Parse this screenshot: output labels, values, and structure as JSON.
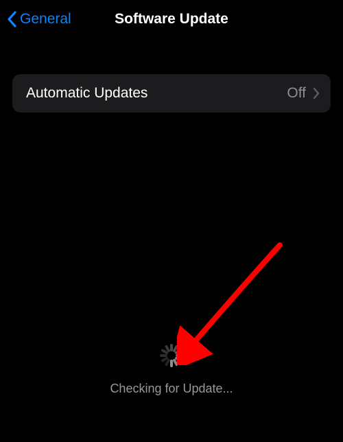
{
  "nav": {
    "back_label": "General",
    "title": "Software Update"
  },
  "settings": {
    "automatic_updates": {
      "label": "Automatic Updates",
      "value": "Off"
    }
  },
  "status": {
    "checking_label": "Checking for Update..."
  }
}
